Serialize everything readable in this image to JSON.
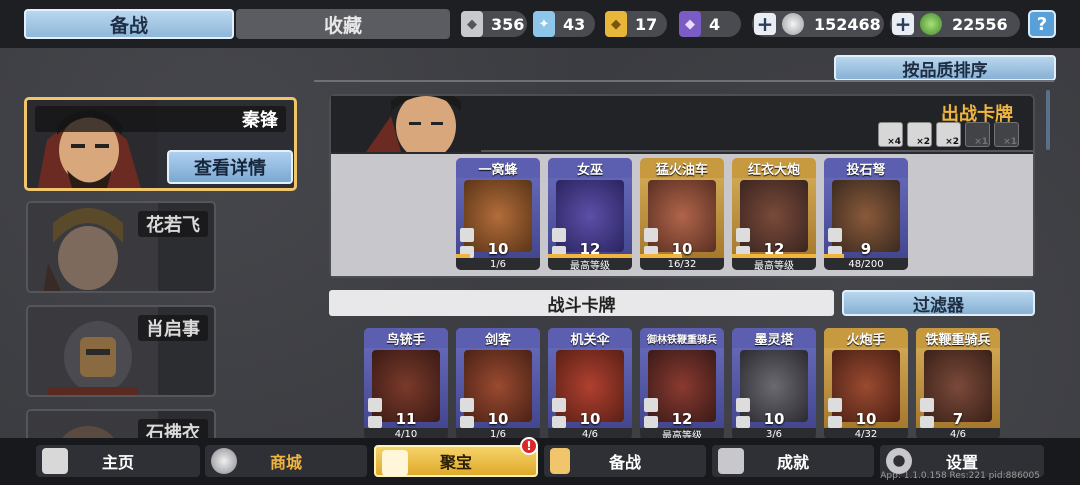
{
  "top_tabs": {
    "active": "备战",
    "inactive": "收藏"
  },
  "resources": [
    {
      "name": "silver-crest-icon",
      "value": "356",
      "color": "#c7c9cf"
    },
    {
      "name": "crystal-icon",
      "value": "43",
      "color": "#8ec6ea"
    },
    {
      "name": "gold-crest-icon",
      "value": "17",
      "color": "#e8b73a"
    },
    {
      "name": "purple-crest-icon",
      "value": "4",
      "color": "#7b5bc4"
    }
  ],
  "currency": [
    {
      "name": "silver-coin-icon",
      "value": "152468"
    },
    {
      "name": "jade-coin-icon",
      "value": "22556"
    }
  ],
  "help_label": "?",
  "sort_button": "按品质排序",
  "heroes": [
    {
      "name": "秦锋",
      "detail_button": "查看详情"
    },
    {
      "name": "花若飞"
    },
    {
      "name": "肖启事"
    },
    {
      "name": "石拂衣"
    }
  ],
  "battle_deck": {
    "title": "出战卡牌",
    "limits": [
      {
        "label": "×4",
        "icon": "sun-icon"
      },
      {
        "label": "×2",
        "icon": "gear-icon"
      },
      {
        "label": "×2",
        "icon": "brick-icon"
      },
      {
        "label": "×1",
        "icon": "skull-icon"
      },
      {
        "label": "×1",
        "icon": "tower-icon"
      }
    ],
    "cards": [
      {
        "name": "一窝蜂",
        "level": "10",
        "progress": "1/6",
        "rarity": "blue",
        "fill": 0.17
      },
      {
        "name": "女巫",
        "level": "12",
        "progress": "最高等级",
        "rarity": "blue",
        "fill": 1.0
      },
      {
        "name": "猛火油车",
        "level": "10",
        "progress": "16/32",
        "rarity": "gold",
        "fill": 0.5
      },
      {
        "name": "红衣大炮",
        "level": "12",
        "progress": "最高等级",
        "rarity": "gold",
        "fill": 1.0
      },
      {
        "name": "投石弩",
        "level": "9",
        "progress": "48/200",
        "rarity": "blue",
        "fill": 0.24
      }
    ]
  },
  "combat_section": {
    "title": "战斗卡牌",
    "filter_button": "过滤器"
  },
  "combat_cards": [
    {
      "name": "鸟铳手",
      "level": "11",
      "progress": "4/10",
      "rarity": "blue"
    },
    {
      "name": "剑客",
      "level": "10",
      "progress": "1/6",
      "rarity": "blue"
    },
    {
      "name": "机关伞",
      "level": "10",
      "progress": "4/6",
      "rarity": "blue"
    },
    {
      "name": "御林铁鞭重骑兵",
      "level": "12",
      "progress": "最高等级",
      "rarity": "blue"
    },
    {
      "name": "墨灵塔",
      "level": "10",
      "progress": "3/6",
      "rarity": "blue"
    },
    {
      "name": "火炮手",
      "level": "10",
      "progress": "4/32",
      "rarity": "gold"
    },
    {
      "name": "铁鞭重骑兵",
      "level": "7",
      "progress": "4/6",
      "rarity": "gold"
    }
  ],
  "bottom_nav": [
    {
      "label": "主页",
      "icon": "home-icon"
    },
    {
      "label": "商城",
      "icon": "coins-icon"
    },
    {
      "label": "聚宝",
      "icon": "treasure-bowl-icon",
      "badge": "!"
    },
    {
      "label": "备战",
      "icon": "cards-icon"
    },
    {
      "label": "成就",
      "icon": "achievement-icon"
    },
    {
      "label": "设置",
      "icon": "gear-icon"
    }
  ],
  "version": "App: 1.1.0.158 Res:221 pid:886005"
}
